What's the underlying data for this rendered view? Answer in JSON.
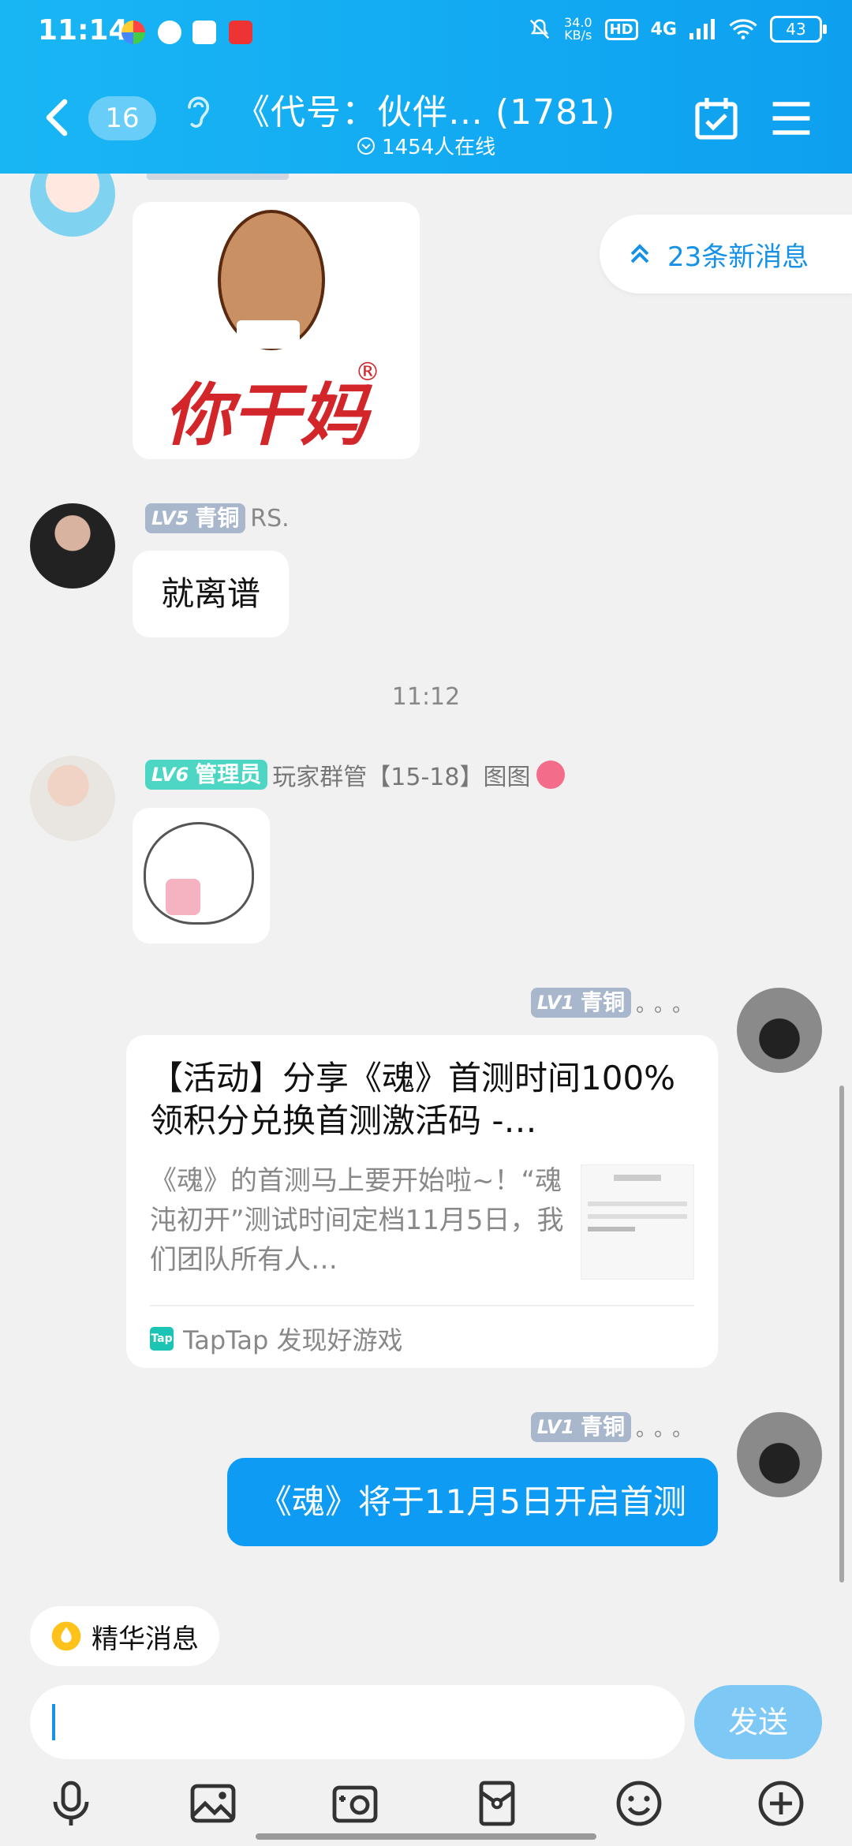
{
  "status_bar": {
    "time": "11:14",
    "speed_value": "34.0",
    "speed_unit": "KB/s",
    "hd": "HD",
    "network": "4G",
    "battery": "43"
  },
  "header": {
    "unread_badge": "16",
    "title": "《代号：伙伴…  (1781)",
    "online": "1454人在线"
  },
  "new_messages": "23条新消息",
  "messages": {
    "msg2": {
      "level_tag": "LV5",
      "level_name": "青铜",
      "nick": "RS.",
      "text": "就离谱"
    },
    "time_sep": "11:12",
    "msg3": {
      "level_tag": "LV6",
      "level_name": "管理员",
      "nick": "玩家群管【15-18】图图"
    },
    "msg4": {
      "level_tag": "LV1",
      "level_name": "青铜",
      "nick": "。。。",
      "card_title": "【活动】分享《魂》首测时间100%领积分兑换首测激活码 -…",
      "card_desc": "《魂》的首测马上要开始啦~！“魂沌初开”测试时间定档11月5日，我们团队所有人…",
      "card_source": "TapTap 发现好游戏",
      "tap_logo": "Tap"
    },
    "msg5": {
      "level_tag": "LV1",
      "level_name": "青铜",
      "nick": "。。。",
      "text": "《魂》将于11月5日开启首测"
    }
  },
  "sticker_text": "你干妈",
  "bottom": {
    "essence_label": "精华消息",
    "send_label": "发送"
  },
  "colors": {
    "header_blue": "#12a9f2",
    "accent_blue": "#0e9bf3",
    "link_blue": "#1591e6"
  },
  "icons": [
    "back-icon",
    "ear-icon",
    "calendar-check-icon",
    "menu-icon",
    "chevron-up-double-icon",
    "microphone-icon",
    "image-icon",
    "camera-icon",
    "red-packet-icon",
    "emoji-icon",
    "plus-icon"
  ]
}
